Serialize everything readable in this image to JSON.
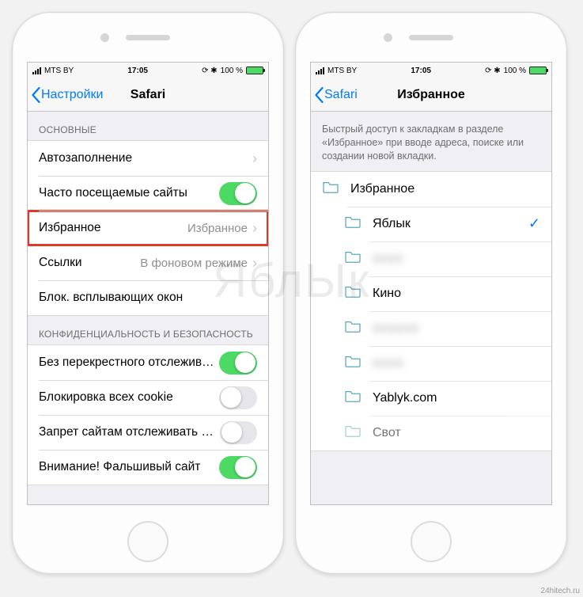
{
  "status_bar": {
    "carrier": "MTS BY",
    "time": "17:05",
    "battery_text": "100 %",
    "bluetooth": "✱"
  },
  "left": {
    "back_label": "Настройки",
    "title": "Safari",
    "groups": {
      "g1_header": "ОСНОВНЫЕ",
      "g2_header": "КОНФИДЕНЦИАЛЬНОСТЬ И БЕЗОПАСНОСТЬ"
    },
    "rows": {
      "autofill": "Автозаполнение",
      "freq_sites": "Часто посещаемые сайты",
      "favorites": "Избранное",
      "favorites_value": "Избранное",
      "links": "Ссылки",
      "links_value": "В фоновом режиме",
      "block_popups": "Блок. всплывающих окон",
      "no_cross": "Без перекрестного отслежива…",
      "block_cookies": "Блокировка всех cookie",
      "deny_track": "Запрет сайтам отслеживать м…",
      "fraud": "Внимание! Фальшивый сайт"
    }
  },
  "right": {
    "back_label": "Safari",
    "title": "Избранное",
    "description": "Быстрый доступ к закладкам в разделе «Избранное» при вводе адреса, поиске или создании новой вкладки.",
    "folders": {
      "root": "Избранное",
      "f1": "Яблык",
      "f2_hidden": "xxxx",
      "f3": "Кино",
      "f4_hidden": "xxxxxx",
      "f5_hidden": "xxxx",
      "f6": "Yablyk.com",
      "f7_partial": "Свот"
    }
  },
  "watermark": "ЯблЫк",
  "credit": "24hitech.ru"
}
